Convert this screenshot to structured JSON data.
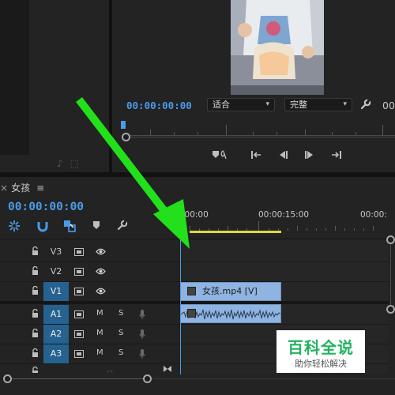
{
  "program_monitor": {
    "timecode": "00:00:00:00",
    "fit_dropdown": "适合",
    "quality_dropdown": "完整",
    "timecode_right_partial": "00"
  },
  "timeline": {
    "tab_close": "×",
    "sequence_name": "女孩",
    "tab_menu": "≡",
    "timecode": "00:00:00:00",
    "ruler_labels": [
      ":00:00",
      "00:00:15:00",
      "00:00:"
    ],
    "tracks": [
      {
        "name": "V3",
        "kind": "video",
        "targeted": false
      },
      {
        "name": "V2",
        "kind": "video",
        "targeted": false
      },
      {
        "name": "V1",
        "kind": "video",
        "targeted": true
      },
      {
        "name": "A1",
        "kind": "audio",
        "targeted": true,
        "mute": "M",
        "solo": "S"
      },
      {
        "name": "A2",
        "kind": "audio",
        "targeted": true,
        "mute": "M",
        "solo": "S"
      },
      {
        "name": "A3",
        "kind": "audio",
        "targeted": true,
        "mute": "M",
        "solo": "S"
      }
    ],
    "video_clip_label": "女孩.mp4 [V]"
  },
  "colors": {
    "accent_blue": "#4a9be8",
    "target_track": "#25628f",
    "clip_blue": "#8fb4e2",
    "work_area": "#e3d640",
    "annotation_arrow": "#22e01a",
    "watermark_green": "#22b35e"
  },
  "icons": {
    "transport": [
      "marker-icon",
      "go-to-in-icon",
      "step-back-icon",
      "step-forward-icon",
      "go-to-out-icon"
    ],
    "tools": [
      "snap-icon",
      "magnet-icon",
      "linked-selection-icon",
      "add-marker-icon",
      "wrench-icon"
    ]
  },
  "watermark": {
    "title": "百科全说",
    "subtitle": "助你轻松解决"
  }
}
